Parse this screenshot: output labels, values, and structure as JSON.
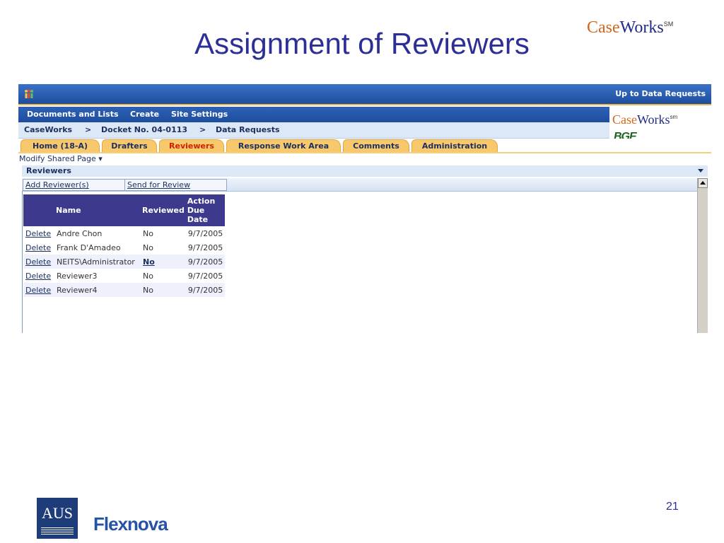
{
  "slide": {
    "title": "Assignment of Reviewers",
    "brand_case": "Case",
    "brand_works": "Works",
    "brand_mark": "SM",
    "page_number": "21",
    "footer_logo_left": "AUS",
    "footer_logo_right": "Flexnova"
  },
  "app": {
    "top_link": "Up to Data Requests",
    "menu": [
      "Documents and Lists",
      "Create",
      "Site Settings"
    ],
    "breadcrumb": [
      "CaseWorks",
      ">",
      "Docket No. 04-0113",
      ">",
      "Data Requests"
    ],
    "logo_case": "Case",
    "logo_works": "Works",
    "logo_mark": "sm",
    "logo_bge": "BGE",
    "tabs": [
      {
        "label": "Home (18-A)",
        "active": false
      },
      {
        "label": "Drafters",
        "active": false
      },
      {
        "label": "Reviewers",
        "active": true
      },
      {
        "label": "Response Work Area",
        "active": false
      },
      {
        "label": "Comments",
        "active": false
      },
      {
        "label": "Administration",
        "active": false
      }
    ],
    "modify_page": "Modify Shared Page",
    "webpart_title": "Reviewers",
    "toolbar": {
      "add": "Add Reviewer(s)",
      "send": "Send for Review"
    },
    "table": {
      "headers": [
        "Name",
        "Reviewed",
        "Action Due Date"
      ],
      "rows": [
        {
          "action": "Delete",
          "name": "Andre Chon",
          "reviewed": "No",
          "date": "9/7/2005"
        },
        {
          "action": "Delete",
          "name": "Frank D'Amadeo",
          "reviewed": "No",
          "date": "9/7/2005"
        },
        {
          "action": "Delete",
          "name": "NEITS\\Administrator",
          "reviewed": "No",
          "date": "9/7/2005"
        },
        {
          "action": "Delete",
          "name": "Reviewer3",
          "reviewed": "No",
          "date": "9/7/2005"
        },
        {
          "action": "Delete",
          "name": "Reviewer4",
          "reviewed": "No",
          "date": "9/7/2005"
        }
      ]
    }
  },
  "colors": {
    "title": "#2d2f97",
    "header": "#3d3a8e",
    "tab": "#f8c86d",
    "active_tab_text": "#cc2200"
  }
}
